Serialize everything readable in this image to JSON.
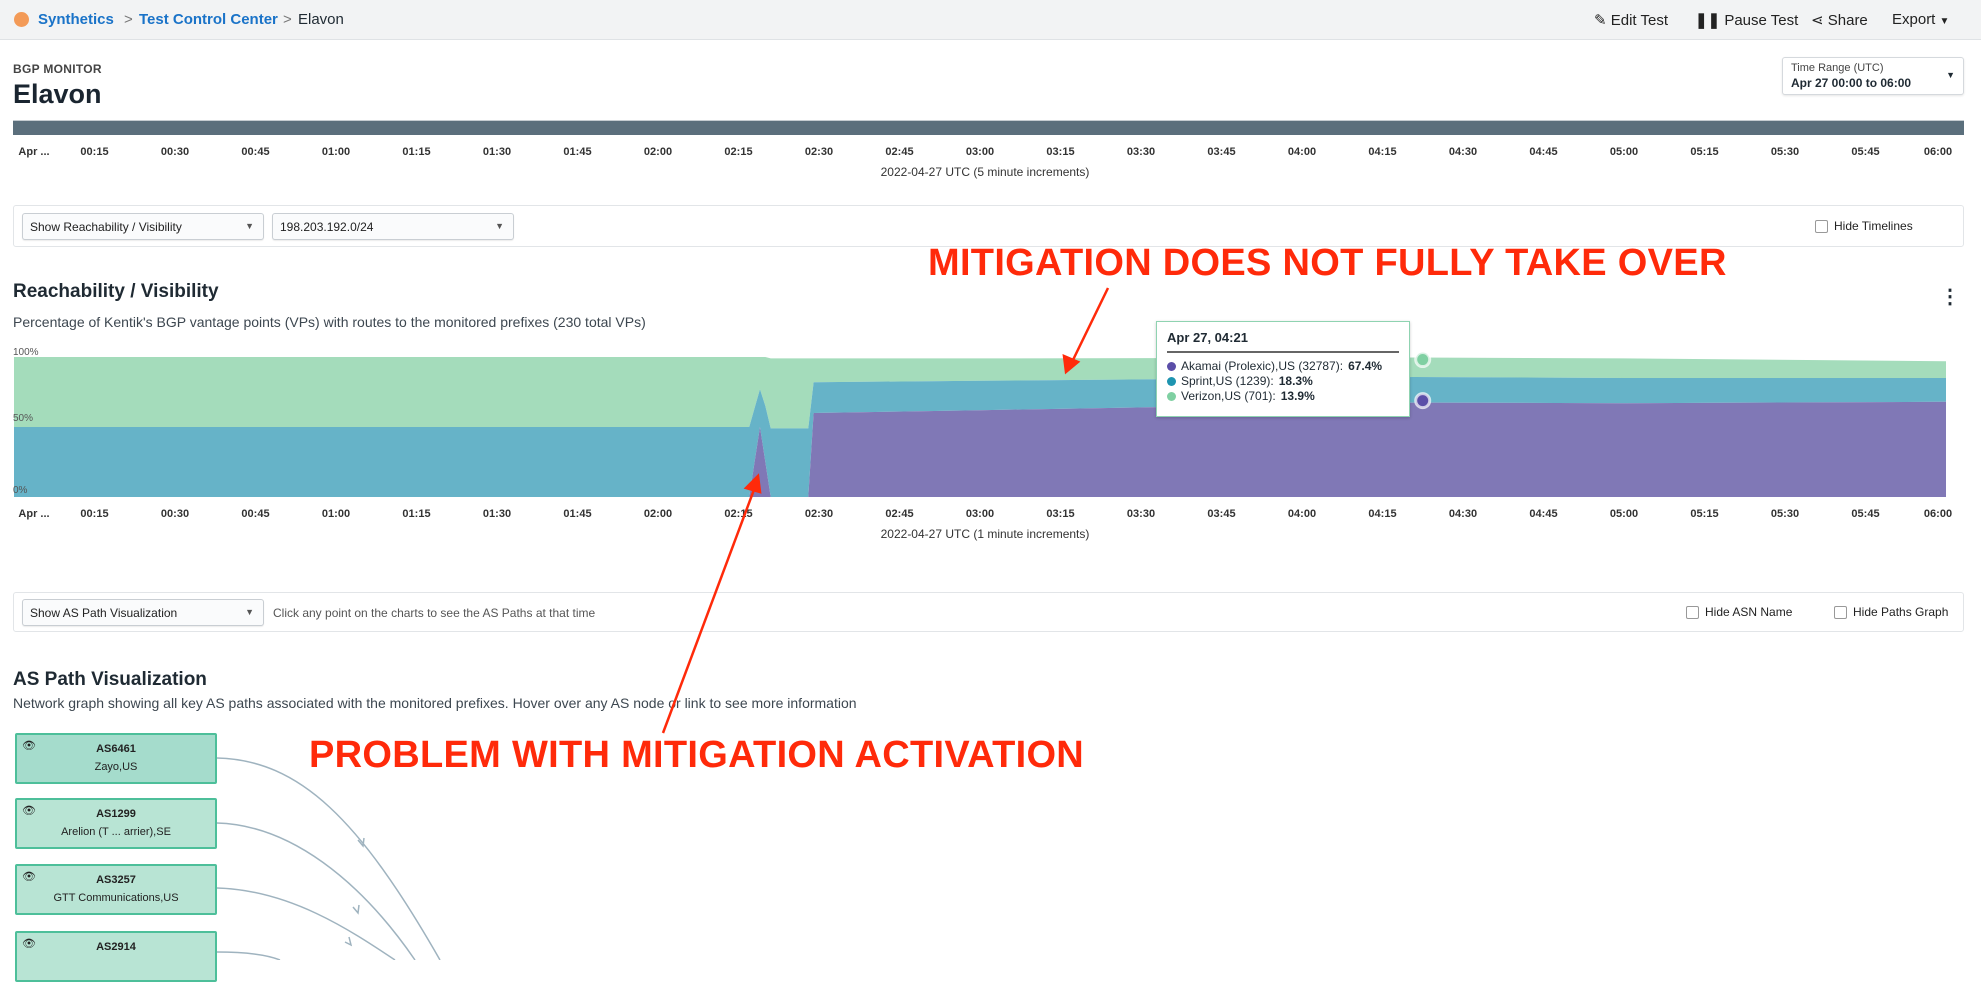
{
  "breadcrumb": {
    "items": [
      "Synthetics",
      "Test Control Center",
      "Elavon"
    ],
    "sep": ">"
  },
  "toolbar": {
    "edit": "Edit Test",
    "pause": "Pause Test",
    "share": "Share",
    "export": "Export"
  },
  "header": {
    "kicker": "BGP MONITOR",
    "title": "Elavon",
    "time_range_label": "Time Range (UTC)",
    "time_range_value": "Apr 27 00:00 to 06:00"
  },
  "timeline": {
    "ticks": [
      "Apr ...",
      "00:15",
      "00:30",
      "00:45",
      "01:00",
      "01:15",
      "01:30",
      "01:45",
      "02:00",
      "02:15",
      "02:30",
      "02:45",
      "03:00",
      "03:15",
      "03:30",
      "03:45",
      "04:00",
      "04:15",
      "04:30",
      "04:45",
      "05:00",
      "05:15",
      "05:30",
      "05:45",
      "06:00"
    ],
    "caption": "2022-04-27 UTC (5 minute increments)"
  },
  "controls1": {
    "view_select": "Show Reachability / Visibility",
    "prefix_select": "198.203.192.0/24",
    "hide_timelines": "Hide Timelines"
  },
  "reach": {
    "title": "Reachability / Visibility",
    "subtitle": "Percentage of Kentik's BGP vantage points (VPs) with routes to the monitored prefixes (230 total VPs)"
  },
  "tooltip": {
    "title": "Apr 27, 04:21",
    "rows": [
      {
        "label": "Akamai (Prolexic),US (32787):",
        "value": "67.4%",
        "color": "#5b4ea8"
      },
      {
        "label": "Sprint,US (1239):",
        "value": "18.3%",
        "color": "#1e94b0"
      },
      {
        "label": "Verizon,US (701):",
        "value": "13.9%",
        "color": "#7fd0a2"
      }
    ]
  },
  "chart_data": {
    "type": "area",
    "stacked": true,
    "y_ticks": [
      "100%",
      "50%",
      "0%"
    ],
    "ylim": [
      0,
      100
    ],
    "x_ticks": [
      "Apr ...",
      "00:15",
      "00:30",
      "00:45",
      "01:00",
      "01:15",
      "01:30",
      "01:45",
      "02:00",
      "02:15",
      "02:30",
      "02:45",
      "03:00",
      "03:15",
      "03:30",
      "03:45",
      "04:00",
      "04:15",
      "04:30",
      "04:45",
      "05:00",
      "05:15",
      "05:30",
      "05:45",
      "06:00"
    ],
    "xlabel": "2022-04-27 UTC (1 minute increments)",
    "x": [
      "00:00",
      "02:17",
      "02:19",
      "02:20",
      "02:21",
      "02:22",
      "02:28",
      "02:29",
      "03:00",
      "04:21",
      "05:00",
      "06:00"
    ],
    "series": [
      {
        "name": "Akamai (Prolexic),US (32787)",
        "color": "#8078b6",
        "values": [
          0,
          0,
          50,
          25,
          0,
          0,
          0,
          60,
          62,
          67.4,
          67,
          68
        ]
      },
      {
        "name": "Sprint,US (1239)",
        "color": "#66b3c8",
        "values": [
          50,
          50,
          27,
          40,
          49,
          49,
          49,
          22,
          21,
          18.3,
          18,
          17
        ]
      },
      {
        "name": "Verizon,US (701)",
        "color": "#a4dcbb",
        "values": [
          50,
          50,
          23,
          35,
          50,
          50,
          50,
          17,
          16,
          13.9,
          14,
          12
        ]
      }
    ],
    "grid": false
  },
  "controls2": {
    "view_select": "Show AS Path Visualization",
    "hint": "Click any point on the charts to see the AS Paths at that time",
    "hide_asn": "Hide ASN Name",
    "hide_paths": "Hide Paths Graph"
  },
  "aspath": {
    "title": "AS Path Visualization",
    "subtitle": "Network graph showing all key AS paths associated with the monitored prefixes. Hover over any AS node or link to see more information",
    "nodes": [
      {
        "asn": "AS6461",
        "name": "Zayo,US"
      },
      {
        "asn": "AS1299",
        "name": "Arelion (T ... arrier),SE"
      },
      {
        "asn": "AS3257",
        "name": "GTT Communications,US"
      },
      {
        "asn": "AS2914",
        "name": ""
      }
    ]
  },
  "annotations": {
    "top": "MITIGATION DOES NOT FULLY TAKE OVER",
    "bottom": "PROBLEM WITH MITIGATION ACTIVATION",
    "color": "#ff2a0a"
  }
}
